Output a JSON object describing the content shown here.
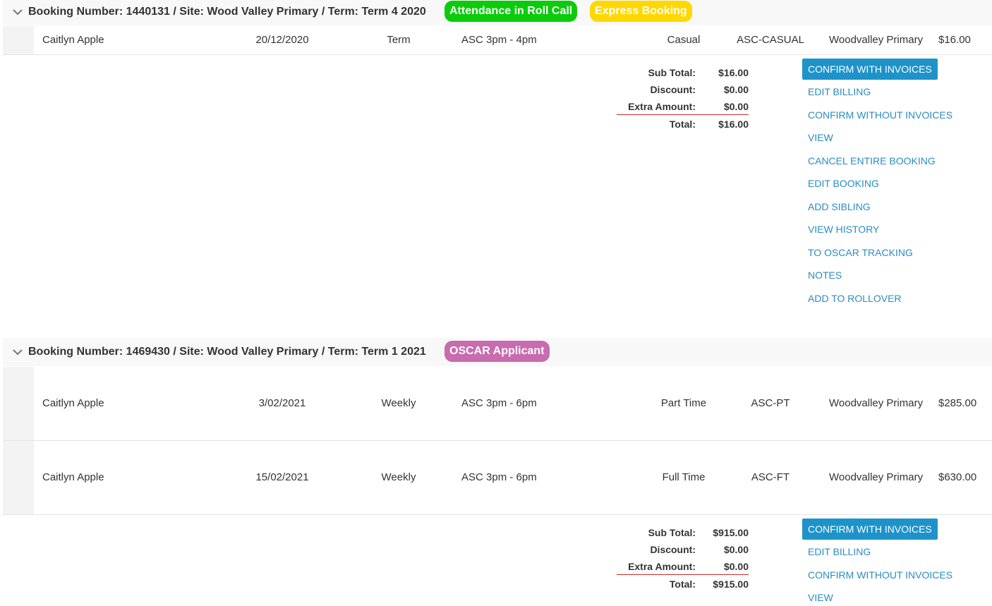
{
  "bookings": [
    {
      "header": "Booking Number: 1440131 / Site: Wood Valley Primary / Term: Term 4 2020",
      "badges": [
        {
          "label": "Attendance in Roll Call",
          "color": "#0bcc0b"
        },
        {
          "label": "Express Booking",
          "color": "#ffd800"
        }
      ],
      "rows": [
        {
          "name": "Caitlyn Apple",
          "date": "20/12/2020",
          "frequency": "Term",
          "session": "ASC 3pm - 4pm",
          "type": "Casual",
          "code": "ASC-CASUAL",
          "site": "Woodvalley Primary",
          "amount": "$16.00"
        }
      ],
      "totals": {
        "sub_total_label": "Sub Total:",
        "sub_total": "$16.00",
        "discount_label": "Discount:",
        "discount": "$0.00",
        "extra_label": "Extra Amount:",
        "extra": "$0.00",
        "total_label": "Total:",
        "total": "$16.00"
      },
      "actions": {
        "confirm_with_invoices": "CONFIRM WITH INVOICES",
        "edit_billing": "EDIT BILLING",
        "confirm_without_invoices": "CONFIRM WITHOUT INVOICES",
        "view": "VIEW",
        "cancel_entire_booking": "CANCEL ENTIRE BOOKING",
        "edit_booking": "EDIT BOOKING",
        "add_sibling": "ADD SIBLING",
        "view_history": "VIEW HISTORY",
        "to_oscar_tracking": "TO OSCAR TRACKING",
        "notes": "NOTES",
        "add_to_rollover": "ADD TO ROLLOVER"
      }
    },
    {
      "header": "Booking Number: 1469430 / Site: Wood Valley Primary / Term: Term 1 2021",
      "badges": [
        {
          "label": "OSCAR Applicant",
          "color": "#c86baf"
        }
      ],
      "rows": [
        {
          "name": "Caitlyn Apple",
          "date": "3/02/2021",
          "frequency": "Weekly",
          "session": "ASC 3pm - 6pm",
          "type": "Part Time",
          "code": "ASC-PT",
          "site": "Woodvalley Primary",
          "amount": "$285.00"
        },
        {
          "name": "Caitlyn Apple",
          "date": "15/02/2021",
          "frequency": "Weekly",
          "session": "ASC 3pm - 6pm",
          "type": "Full Time",
          "code": "ASC-FT",
          "site": "Woodvalley Primary",
          "amount": "$630.00"
        }
      ],
      "totals": {
        "sub_total_label": "Sub Total:",
        "sub_total": "$915.00",
        "discount_label": "Discount:",
        "discount": "$0.00",
        "extra_label": "Extra Amount:",
        "extra": "$0.00",
        "total_label": "Total:",
        "total": "$915.00"
      },
      "actions": {
        "confirm_with_invoices": "CONFIRM WITH INVOICES",
        "edit_billing": "EDIT BILLING",
        "confirm_without_invoices": "CONFIRM WITHOUT INVOICES",
        "view": "VIEW"
      }
    }
  ]
}
